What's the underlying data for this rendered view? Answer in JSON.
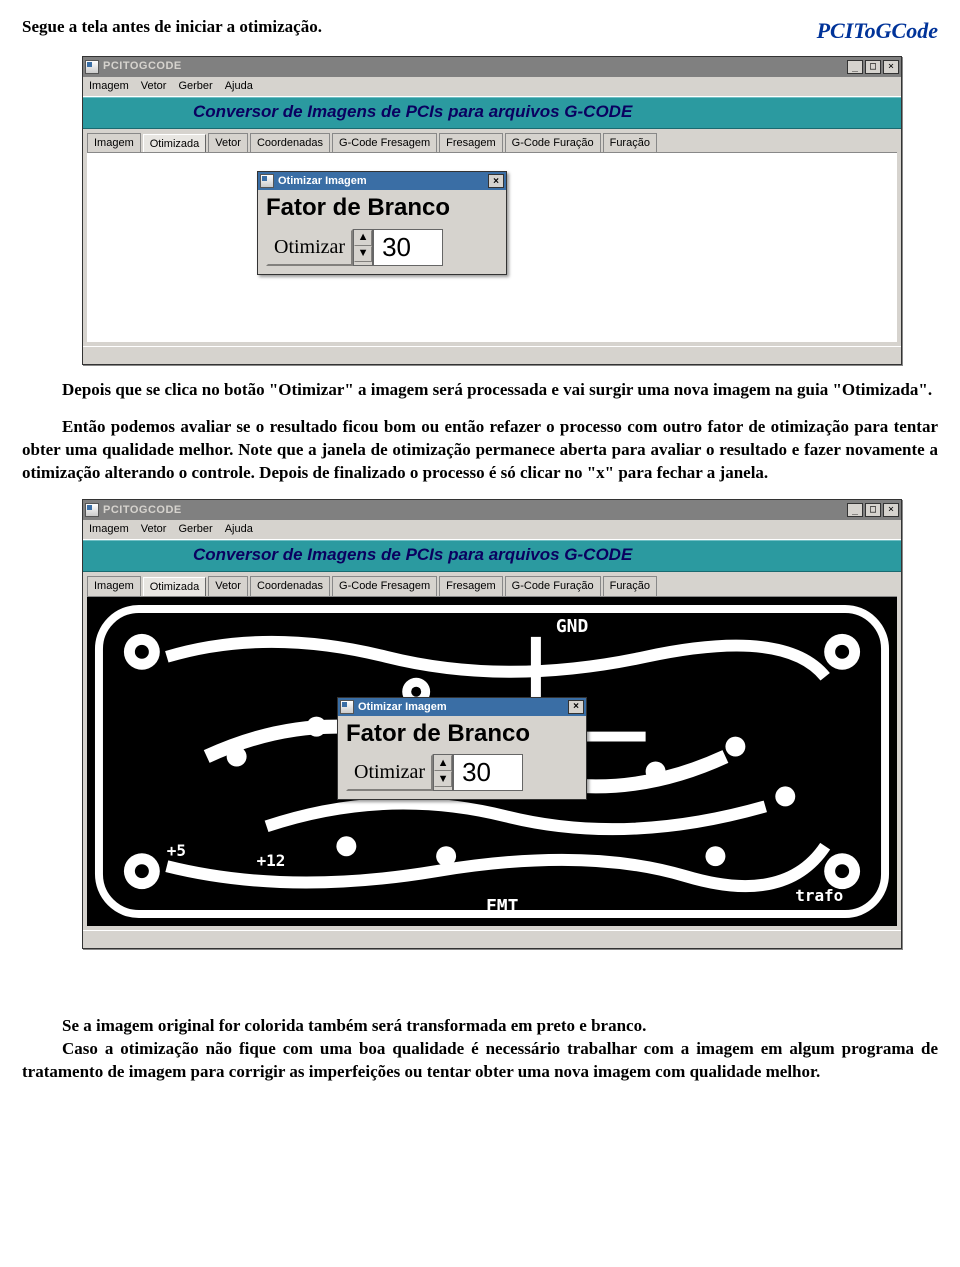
{
  "header": {
    "appname": "PCIToGCode",
    "intro": "Segue a tela antes de iniciar a otimização."
  },
  "paragraphs": {
    "p1": "Depois que se clica no botão \"Otimizar\" a imagem será processada e vai surgir uma nova imagem na guia \"Otimizada\".",
    "p2": "Então podemos avaliar se o resultado ficou bom ou então refazer o processo com outro fator de otimização para tentar obter uma qualidade melhor. Note que a janela de otimização permanece aberta para avaliar o resultado e fazer novamente a otimização alterando o controle. Depois de finalizado o processo é só clicar no \"x\" para fechar a janela.",
    "p3": "Se a imagem original for colorida também será transformada em preto e branco.",
    "p4": "Caso a otimização não fique com uma boa qualidade é necessário trabalhar com a imagem em algum programa de tratamento de imagem para corrigir as imperfeições ou tentar obter uma nova imagem com qualidade melhor."
  },
  "window": {
    "title": "PCITOGCODE",
    "menu": [
      "Imagem",
      "Vetor",
      "Gerber",
      "Ajuda"
    ],
    "banner": "Conversor de Imagens de PCIs para arquivos G-CODE",
    "tabs": [
      "Imagem",
      "Otimizada",
      "Vetor",
      "Coordenadas",
      "G-Code Fresagem",
      "Fresagem",
      "G-Code Furação",
      "Furação"
    ],
    "active_tab_index": 1,
    "win_buttons": {
      "min": "_",
      "max": "□",
      "close": "×"
    }
  },
  "dialog": {
    "title": "Otimizar Imagem",
    "heading": "Fator de Branco",
    "button": "Otimizar",
    "value": "30",
    "spin_up": "▲",
    "spin_down": "▼",
    "close": "×"
  },
  "pcb_labels": {
    "gnd": "GND",
    "p5": "+5",
    "p12": "+12",
    "fmt": "FMT",
    "trafo": "trafo"
  }
}
